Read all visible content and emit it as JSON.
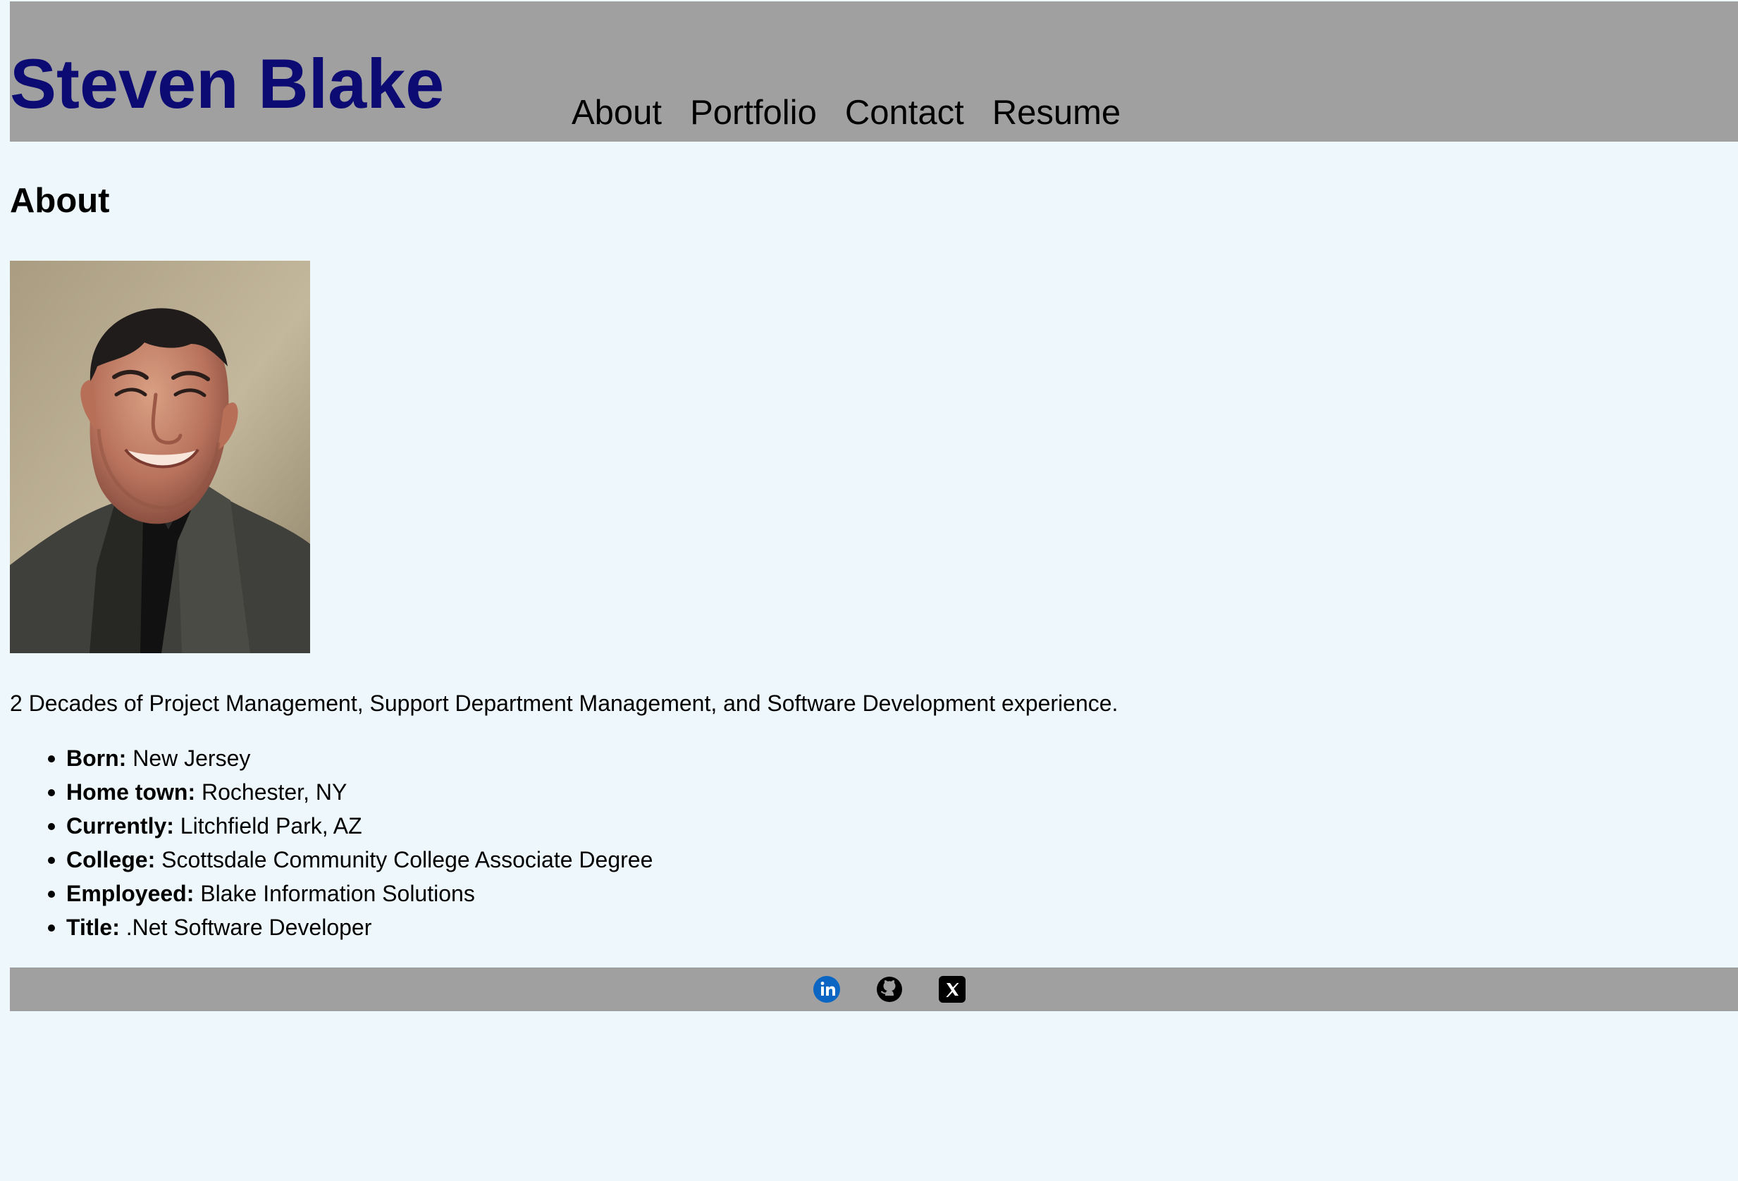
{
  "header": {
    "site_title": "Steven Blake",
    "title_color": "#0c0a73",
    "background_color": "#a0a0a0",
    "nav": [
      {
        "label": "About"
      },
      {
        "label": "Portfolio"
      },
      {
        "label": "Contact"
      },
      {
        "label": "Resume"
      }
    ]
  },
  "main": {
    "background_color": "#edf7fc",
    "heading": "About",
    "photo": {
      "icon": "profile-photo"
    },
    "intro": "2 Decades of Project Management, Support Department Management, and Software Development experience.",
    "facts": [
      {
        "label": "Born:",
        "value": "New Jersey"
      },
      {
        "label": "Home town:",
        "value": "Rochester, NY"
      },
      {
        "label": "Currently:",
        "value": "Litchfield Park, AZ"
      },
      {
        "label": "College:",
        "value": "Scottsdale Community College Associate Degree"
      },
      {
        "label": "Employeed:",
        "value": "Blake Information Solutions"
      },
      {
        "label": "Title:",
        "value": ".Net Software Developer"
      }
    ]
  },
  "footer": {
    "background_color": "#a0a0a0",
    "social": [
      {
        "icon": "linkedin-icon",
        "color": "#0a66c2"
      },
      {
        "icon": "github-icon",
        "color": "#000000"
      },
      {
        "icon": "x-icon",
        "color": "#000000"
      }
    ]
  }
}
